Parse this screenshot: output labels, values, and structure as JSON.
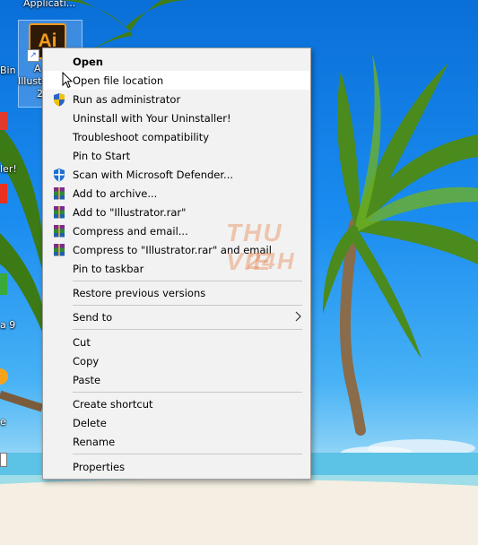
{
  "desktop": {
    "top_label": "Applicati...",
    "ai_icon": {
      "logo_text": "Ai",
      "label_line1": "A",
      "label_line2": "Illustra",
      "label_line3": "2"
    },
    "left_labels": [
      "Bin",
      "ler!",
      "a 9",
      "e"
    ]
  },
  "context_menu": {
    "items": [
      {
        "label": "Open",
        "icon": "",
        "bold": true
      },
      {
        "label": "Open file location",
        "icon": "",
        "hover": true
      },
      {
        "label": "Run as administrator",
        "icon": "uac-shield-icon"
      },
      {
        "label": "Uninstall with Your Uninstaller!",
        "icon": ""
      },
      {
        "label": "Troubleshoot compatibility",
        "icon": ""
      },
      {
        "label": "Pin to Start",
        "icon": ""
      },
      {
        "label": "Scan with Microsoft Defender...",
        "icon": "defender-icon"
      },
      {
        "label": "Add to archive...",
        "icon": "winrar-icon"
      },
      {
        "label": "Add to \"Illustrator.rar\"",
        "icon": "winrar-icon"
      },
      {
        "label": "Compress and email...",
        "icon": "winrar-icon"
      },
      {
        "label": "Compress to \"Illustrator.rar\" and email",
        "icon": "winrar-icon"
      },
      {
        "label": "Pin to taskbar",
        "icon": ""
      },
      {
        "label": "Restore previous versions",
        "icon": ""
      },
      {
        "label": "Send to",
        "icon": "",
        "submenu": true
      },
      {
        "label": "Cut",
        "icon": ""
      },
      {
        "label": "Copy",
        "icon": ""
      },
      {
        "label": "Paste",
        "icon": ""
      },
      {
        "label": "Create shortcut",
        "icon": ""
      },
      {
        "label": "Delete",
        "icon": ""
      },
      {
        "label": "Rename",
        "icon": ""
      },
      {
        "label": "Properties",
        "icon": ""
      }
    ]
  },
  "watermark": {
    "line1": "THU VIE",
    "line2": "24H"
  },
  "colors": {
    "menu_bg": "#f2f2f2",
    "hover_bg": "#ffffff",
    "separator": "#c8c8c8",
    "ai_orange": "#f39b1d"
  }
}
